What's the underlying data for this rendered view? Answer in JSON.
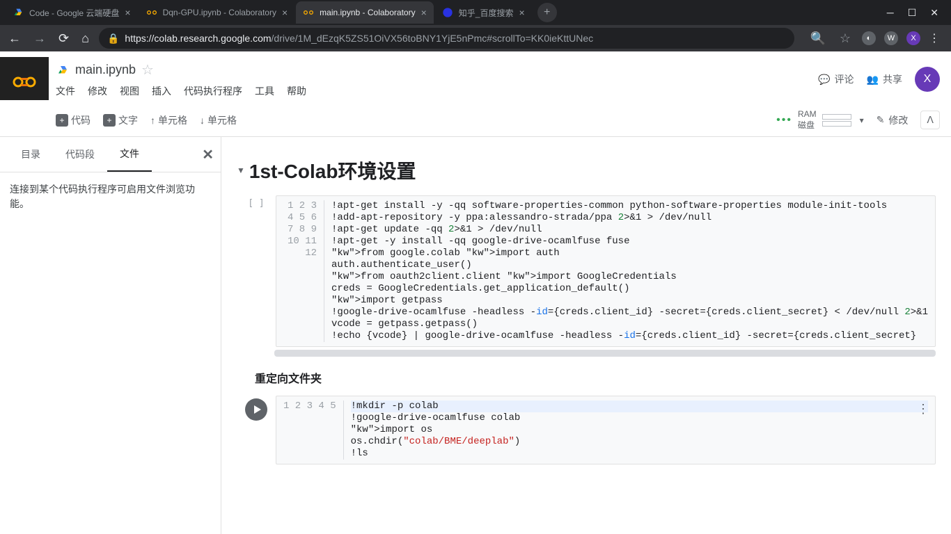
{
  "browser": {
    "tabs": [
      {
        "title": "Code - Google 云端硬盘",
        "icon": "drive"
      },
      {
        "title": "Dqn-GPU.ipynb - Colaboratory",
        "icon": "colab"
      },
      {
        "title": "main.ipynb - Colaboratory",
        "icon": "colab",
        "active": true
      },
      {
        "title": "知乎_百度搜索",
        "icon": "baidu"
      }
    ],
    "url_host": "https://colab.research.google.com",
    "url_path": "/drive/1M_dEzqK5ZS51OiVX56toBNY1YjE5nPmc#scrollTo=KK0ieKttUNec",
    "avatar_letter": "X"
  },
  "colab": {
    "title": "main.ipynb",
    "menu": [
      "文件",
      "修改",
      "视图",
      "插入",
      "代码执行程序",
      "工具",
      "帮助"
    ],
    "header_right": {
      "comment": "评论",
      "share": "共享",
      "avatar": "X"
    },
    "toolbar": {
      "code": "代码",
      "text": "文字",
      "cell_up": "单元格",
      "cell_down": "单元格",
      "ram_label": "RAM",
      "disk_label": "磁盘",
      "edit": "修改"
    },
    "side": {
      "tabs": [
        "目录",
        "代码段",
        "文件"
      ],
      "active": 2,
      "content": "连接到某个代码执行程序可启用文件浏览功能。"
    },
    "section1_title": "1st-Colab环境设置",
    "cell1_lines": [
      "!apt-get install -y -qq software-properties-common python-software-properties module-init-tools",
      "!add-apt-repository -y ppa:alessandro-strada/ppa 2>&1 > /dev/null",
      "!apt-get update -qq 2>&1 > /dev/null",
      "!apt-get -y install -qq google-drive-ocamlfuse fuse",
      "from google.colab import auth",
      "auth.authenticate_user()",
      "from oauth2client.client import GoogleCredentials",
      "creds = GoogleCredentials.get_application_default()",
      "import getpass",
      "!google-drive-ocamlfuse -headless -id={creds.client_id} -secret={creds.client_secret} < /dev/null 2>&1",
      "vcode = getpass.getpass()",
      "!echo {vcode} | google-drive-ocamlfuse -headless -id={creds.client_id} -secret={creds.client_secret}"
    ],
    "text_block": "重定向文件夹",
    "cell2_lines": [
      "!mkdir -p colab",
      "!google-drive-ocamlfuse colab",
      "import os",
      "os.chdir(\"colab/BME/deeplab\")",
      "!ls"
    ]
  }
}
